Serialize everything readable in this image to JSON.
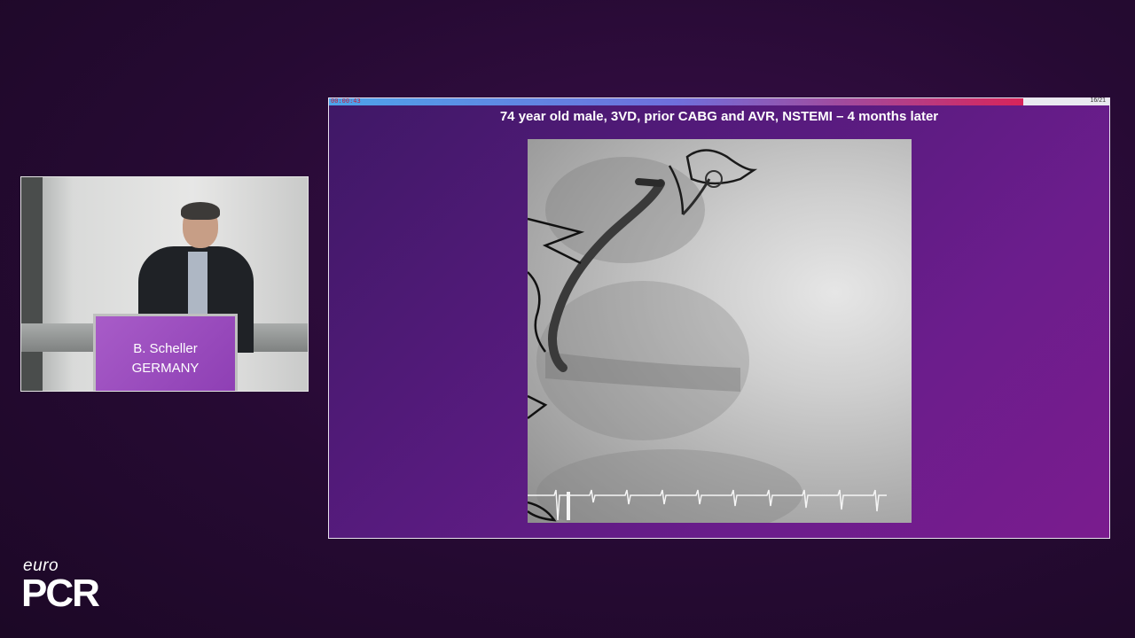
{
  "speaker": {
    "name": "B. Scheller",
    "country": "GERMANY"
  },
  "slide": {
    "elapsed_time": "00:00:43",
    "counter": "16/21",
    "progress": 0.89,
    "title": "74 year old male, 3VD, prior CABG and AVR, NSTEMI – 4 months later"
  },
  "logo": {
    "top": "euro",
    "bottom": "PCR"
  },
  "colors": {
    "background": "#260a33",
    "slide_bg": "#571b7e",
    "podium": "#9b4cc0",
    "progress_start": "#4da4ea",
    "progress_end": "#d8245a"
  }
}
